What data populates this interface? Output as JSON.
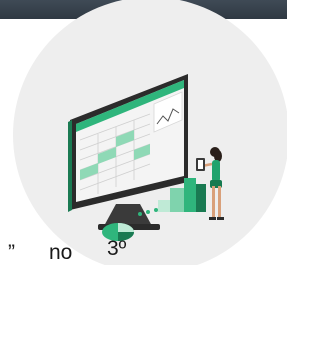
{
  "caption": {
    "quote_mark": "”",
    "word": "no",
    "ordinal": "3º"
  },
  "icons": {
    "illustration": "analytics-dashboard-illustration",
    "header": "dark-header-bar"
  },
  "colors": {
    "header": "#36404a",
    "accent": "#1fa36d",
    "circle_bg": "#eeeeee",
    "monitor": "#2b2b2b"
  }
}
